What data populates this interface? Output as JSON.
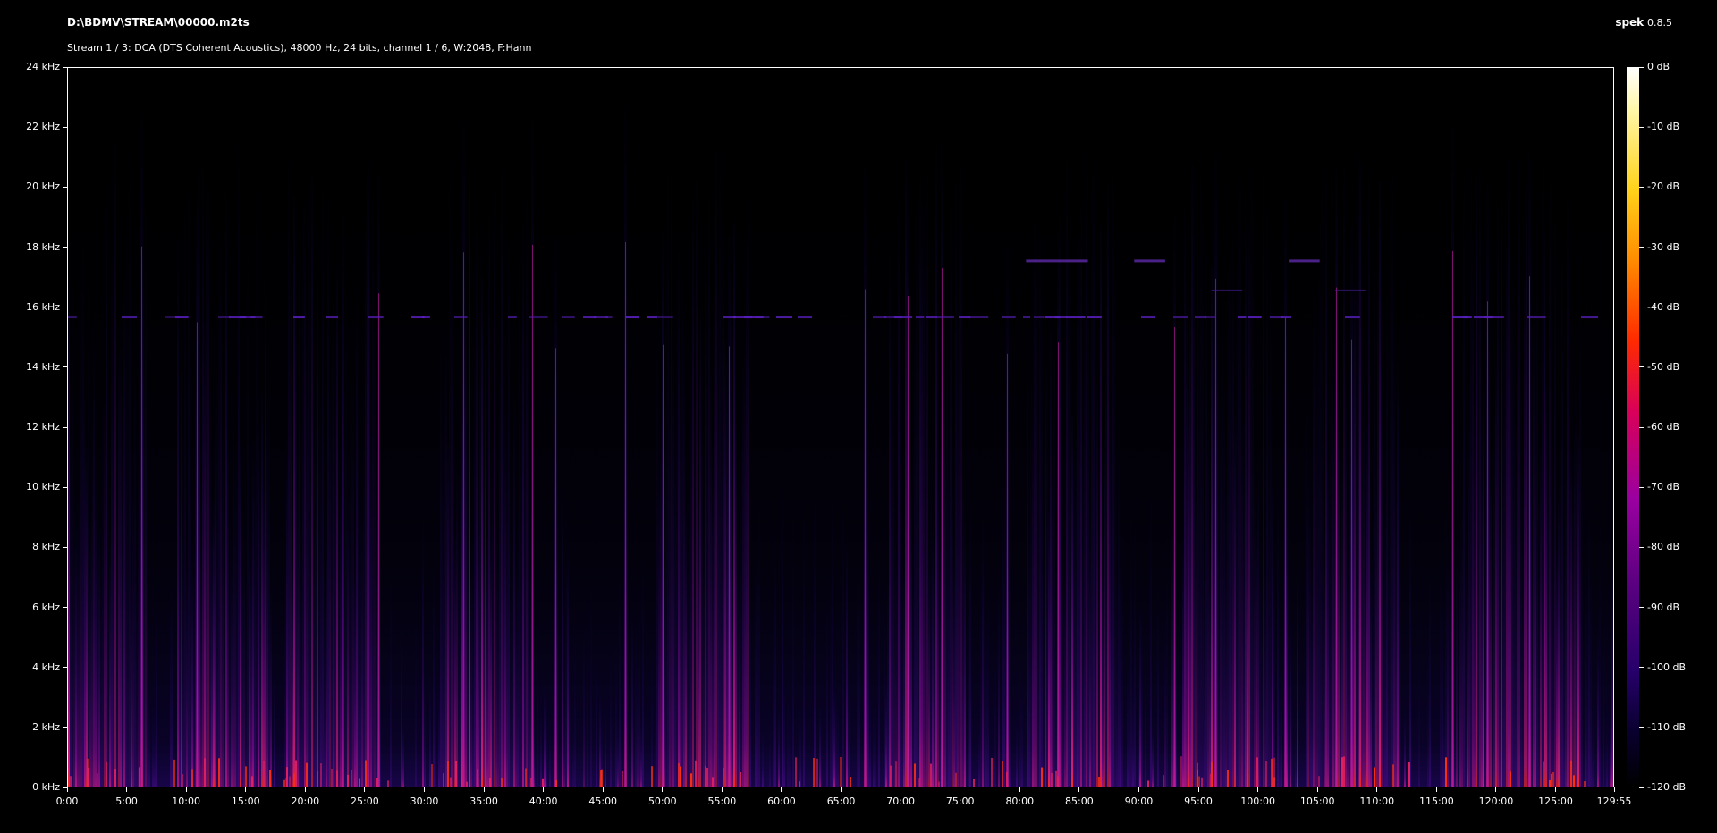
{
  "header": {
    "file_path": "D:\\BDMV\\STREAM\\00000.m2ts",
    "stream_info": "Stream 1 / 3: DCA (DTS Coherent Acoustics), 48000 Hz, 24 bits, channel 1 / 6, W:2048, F:Hann",
    "app_name": "spek",
    "app_version": "0.8.5"
  },
  "spectrogram": {
    "freq_axis": {
      "unit": "kHz",
      "range": [
        0,
        24
      ],
      "ticks": [
        "0 kHz",
        "2 kHz",
        "4 kHz",
        "6 kHz",
        "8 kHz",
        "10 kHz",
        "12 kHz",
        "14 kHz",
        "16 kHz",
        "18 kHz",
        "20 kHz",
        "22 kHz",
        "24 kHz"
      ]
    },
    "time_axis": {
      "range_minutes": [
        0,
        129.9167
      ],
      "ticks": [
        "0:00",
        "5:00",
        "10:00",
        "15:00",
        "20:00",
        "25:00",
        "30:00",
        "35:00",
        "40:00",
        "45:00",
        "50:00",
        "55:00",
        "60:00",
        "65:00",
        "70:00",
        "75:00",
        "80:00",
        "85:00",
        "90:00",
        "95:00",
        "100:00",
        "105:00",
        "110:00",
        "115:00",
        "120:00",
        "125:00",
        "129:55"
      ]
    },
    "db_scale": {
      "range": [
        -120,
        0
      ],
      "ticks": [
        "0 dB",
        "-10 dB",
        "-20 dB",
        "-30 dB",
        "-40 dB",
        "-50 dB",
        "-60 dB",
        "-70 dB",
        "-80 dB",
        "-90 dB",
        "-100 dB",
        "-110 dB",
        "-120 dB"
      ]
    },
    "colors": {
      "low": "#0a0030",
      "mid": "#9a00a0",
      "high": "#ff2a00",
      "peak": "#ffffff"
    }
  }
}
